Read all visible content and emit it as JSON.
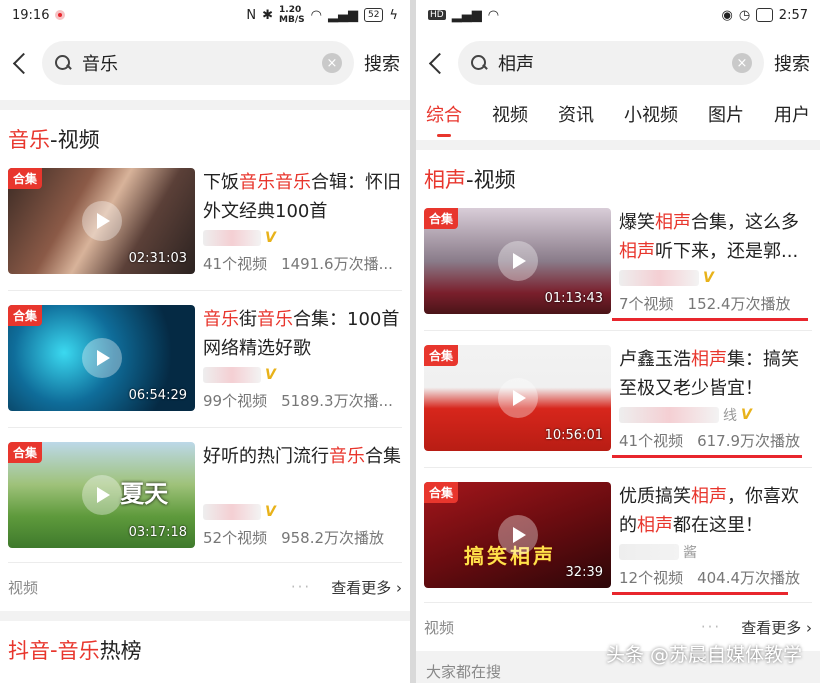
{
  "left": {
    "status": {
      "time": "19:16",
      "speed": "1.20",
      "speed_unit": "MB/S",
      "battery": "52"
    },
    "search": {
      "query": "音乐",
      "button": "搜索"
    },
    "section": {
      "title_red": "音乐",
      "title_rest": "-视频"
    },
    "cards": [
      {
        "tag": "合集",
        "duration": "02:31:03",
        "t1": "下饭",
        "h1": "音乐音乐",
        "t2": "合辑：怀旧外文经典100首",
        "stats_count": "41个视频",
        "stats_plays": "1491.6万次播..."
      },
      {
        "tag": "合集",
        "duration": "06:54:29",
        "t1": "",
        "h1": "音乐",
        "t2": "街",
        "h2": "音乐",
        "t3": "合集：100首网络精选好歌",
        "stats_count": "99个视频",
        "stats_plays": "5189.3万次播..."
      },
      {
        "tag": "合集",
        "duration": "03:17:18",
        "overlay": "夏天",
        "t1": "好听的热门流行",
        "h1": "音乐",
        "t2": "合集",
        "stats_count": "52个视频",
        "stats_plays": "958.2万次播放"
      }
    ],
    "footer": {
      "label": "视频",
      "dots": "···",
      "more": "查看更多"
    },
    "next_section": {
      "part1": "抖音",
      "part2": "-",
      "part3": "音乐",
      "part4": "热榜"
    }
  },
  "right": {
    "status": {
      "time": "2:57"
    },
    "search": {
      "query": "相声",
      "button": "搜索"
    },
    "tabs": [
      "综合",
      "视频",
      "资讯",
      "小视频",
      "图片",
      "用户"
    ],
    "section": {
      "title_red": "相声",
      "title_rest": "-视频"
    },
    "cards": [
      {
        "tag": "合集",
        "duration": "01:13:43",
        "t1": "爆笑",
        "h1": "相声",
        "t2": "合集，这么多",
        "h2": "相声",
        "t3": "听下来，还是郭...",
        "stats_count": "7个视频",
        "stats_plays": "152.4万次播放"
      },
      {
        "tag": "合集",
        "duration": "10:56:01",
        "t1": "卢鑫玉浩",
        "h1": "相声",
        "t2": "集：搞笑至极又老少皆宜！",
        "author_suffix": "线",
        "stats_count": "41个视频",
        "stats_plays": "617.9万次播放"
      },
      {
        "tag": "合集",
        "duration": "32:39",
        "overlay": "搞笑相声",
        "t1": "优质搞笑",
        "h1": "相声",
        "t2": "，你喜欢的",
        "h2": "相声",
        "t3": "都在这里！",
        "author_suffix": "酱",
        "stats_count": "12个视频",
        "stats_plays": "404.4万次播放"
      }
    ],
    "footer": {
      "label": "视频",
      "dots": "···",
      "more": "查看更多"
    },
    "next_section": "大家都在搜"
  },
  "watermark": "头条 @苏晨自媒体教学",
  "colors": {
    "accent": "#e8362d",
    "annotation": "#e8262d"
  }
}
